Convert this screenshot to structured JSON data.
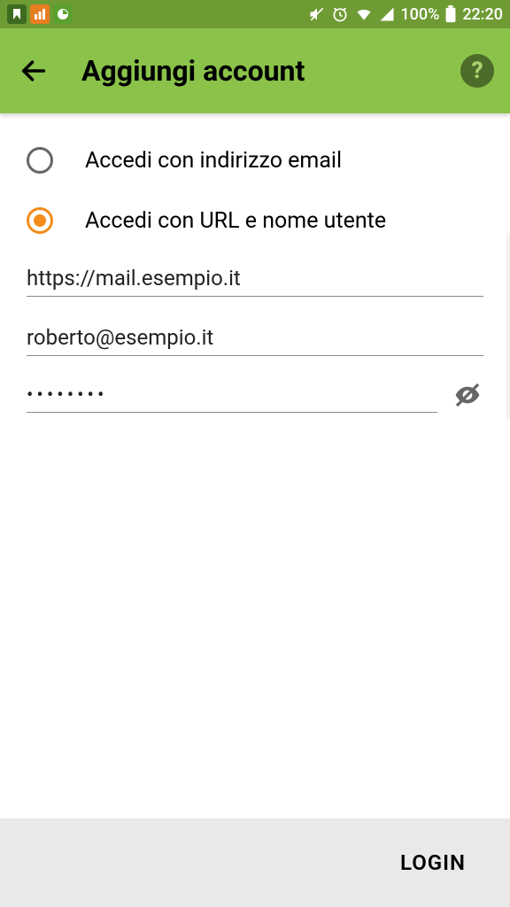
{
  "statusbar": {
    "battery_text": "100%",
    "time": "22:20"
  },
  "appbar": {
    "title": "Aggiungi account"
  },
  "options": {
    "email": {
      "label": "Accedi con indirizzo email",
      "selected": false
    },
    "url": {
      "label": "Accedi con URL e nome utente",
      "selected": true
    }
  },
  "fields": {
    "url": "https://mail.esempio.it",
    "user": "roberto@esempio.it",
    "password": "••••••••"
  },
  "footer": {
    "login_label": "LOGIN"
  }
}
